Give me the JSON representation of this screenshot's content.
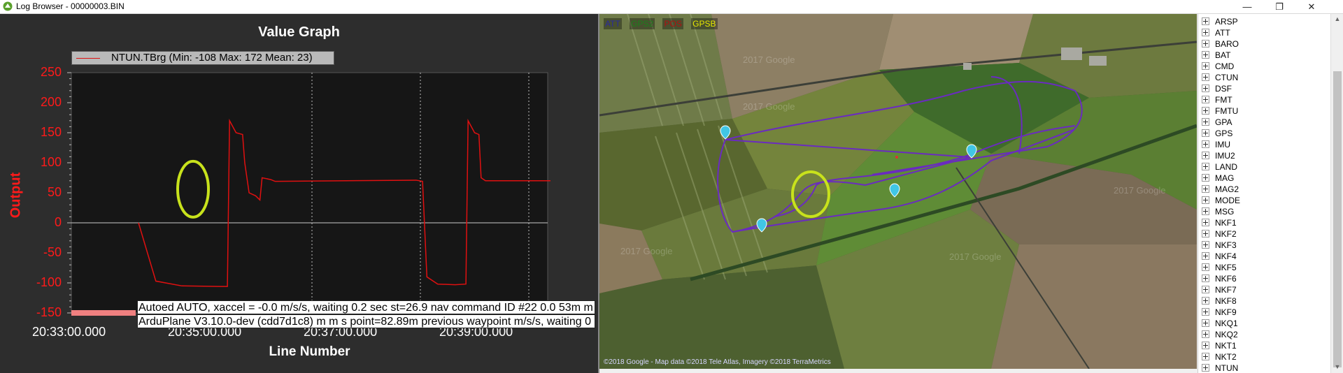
{
  "window": {
    "title": "Log Browser - 00000003.BIN",
    "minimize_glyph": "—",
    "maximize_glyph": "❐",
    "close_glyph": "✕"
  },
  "graph": {
    "title": "Value Graph",
    "legend": "NTUN.TBrg (Min: -108 Max: 172 Mean: 23)",
    "y_label": "Output",
    "x_label": "Line Number",
    "y_ticks": [
      "250",
      "200",
      "150",
      "100",
      "50",
      "0",
      "-50",
      "-100",
      "-150"
    ],
    "x_ticks": [
      "20:33:00.000",
      "20:35:00.000",
      "20:37:00.000",
      "20:39:00.000"
    ],
    "messages": [
      "Autoed AUTO, xaccel = -0.0 m/s/s, waiting 0.2 sec  st=26.9  nav command ID #22 0.0  53m m",
      "ArduPlane V3.10.0-dev (cdd7d1c8)  m  m  s  point=82.89m  previous waypoint m/s/s, waiting 0"
    ],
    "colors": {
      "series": "#e01010",
      "axis_text": "#ff1a1a"
    }
  },
  "chart_data": {
    "type": "line",
    "title": "Value Graph",
    "xlabel": "Line Number",
    "ylabel": "Output",
    "ylim": [
      -150,
      250
    ],
    "grid": true,
    "legend_placement": "top-left",
    "series": [
      {
        "name": "NTUN.TBrg (Min: -108 Max: 172 Mean: 23)",
        "color": "#e01010",
        "points": [
          [
            0.0,
            0
          ],
          [
            0.4,
            -97
          ],
          [
            1.0,
            -105
          ],
          [
            1.9,
            -106
          ],
          [
            2.05,
            -106
          ],
          [
            2.1,
            170
          ],
          [
            2.25,
            150
          ],
          [
            2.4,
            147
          ],
          [
            2.45,
            100
          ],
          [
            2.55,
            50
          ],
          [
            2.7,
            45
          ],
          [
            2.8,
            38
          ],
          [
            2.85,
            75
          ],
          [
            3.05,
            72
          ],
          [
            3.15,
            69
          ],
          [
            6.4,
            71
          ],
          [
            6.55,
            69
          ],
          [
            6.65,
            -90
          ],
          [
            6.9,
            -102
          ],
          [
            7.3,
            -103
          ],
          [
            7.55,
            -102
          ],
          [
            7.6,
            170
          ],
          [
            7.75,
            150
          ],
          [
            7.85,
            147
          ],
          [
            7.9,
            75
          ],
          [
            8.0,
            70
          ],
          [
            9.5,
            70
          ]
        ]
      }
    ],
    "x_tick_values": [
      "20:33:00.000",
      "20:35:00.000",
      "20:37:00.000",
      "20:39:00.000"
    ]
  },
  "map": {
    "legend": [
      {
        "label": "ATT",
        "color": "#2a2aa0"
      },
      {
        "label": "GPS2",
        "color": "#1c7f1c"
      },
      {
        "label": "POS",
        "color": "#b01010"
      },
      {
        "label": "GPSB",
        "color": "#e6e600"
      }
    ],
    "watermark": "2017 Google",
    "footer": "©2018 Google - Map data ©2018 Tele Atlas, Imagery ©2018 TerraMetrics",
    "track_color": "#6a2bc0",
    "highlight_color": "#c8e21c"
  },
  "tree": {
    "items": [
      "ARSP",
      "ATT",
      "BARO",
      "BAT",
      "CMD",
      "CTUN",
      "DSF",
      "FMT",
      "FMTU",
      "GPA",
      "GPS",
      "IMU",
      "IMU2",
      "LAND",
      "MAG",
      "MAG2",
      "MODE",
      "MSG",
      "NKF1",
      "NKF2",
      "NKF3",
      "NKF4",
      "NKF5",
      "NKF6",
      "NKF7",
      "NKF8",
      "NKF9",
      "NKQ1",
      "NKQ2",
      "NKT1",
      "NKT2",
      "NTUN"
    ]
  }
}
